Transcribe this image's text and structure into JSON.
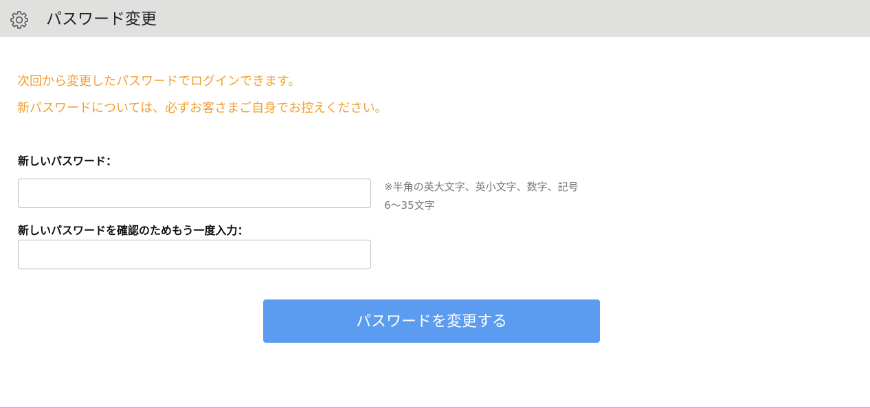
{
  "header": {
    "icon": "gear-icon",
    "title": "パスワード変更"
  },
  "notice": {
    "line1": "次回から変更したパスワードでログインできます。",
    "line2": "新パスワードについては、必ずお客さまご自身でお控えください。",
    "color": "#f0a030"
  },
  "form": {
    "new_password": {
      "label": "新しいパスワード：",
      "value": "",
      "placeholder": ""
    },
    "confirm_password": {
      "label": "新しいパスワードを確認のためもう一度入力：",
      "value": "",
      "placeholder": ""
    },
    "hint": {
      "line1": "※半角の英大文字、英小文字、数字、記号",
      "line2": "6～35文字"
    },
    "submit": {
      "label": "パスワードを変更する",
      "color": "#5b9cf0"
    }
  }
}
